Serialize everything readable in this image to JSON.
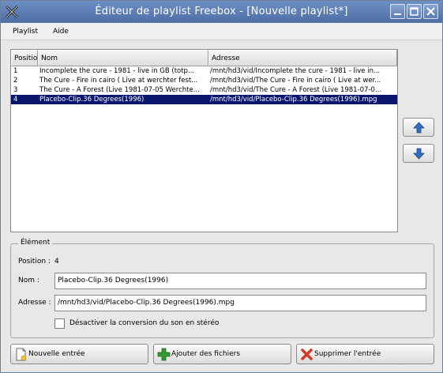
{
  "window": {
    "title": "Éditeur de playlist Freebox - [Nouvelle playlist*]",
    "controls": [
      "minimize-icon",
      "maximize-icon",
      "close-icon"
    ]
  },
  "menu": {
    "items": [
      "Playlist",
      "Aide"
    ]
  },
  "table": {
    "columns": [
      "Positio",
      "Nom",
      "Adresse"
    ],
    "rows": [
      {
        "position": "1",
        "nom": "Incomplete the cure - 1981 - live in GB (totp...",
        "adresse": "/mnt/hd3/vid/Incomplete the cure - 1981 - live in..."
      },
      {
        "position": "2",
        "nom": "The Cure - Fire in cairo ( Live at werchter fest...",
        "adresse": "/mnt/hd3/vid/The Cure - Fire in cairo ( Live at wer..."
      },
      {
        "position": "3",
        "nom": "The Cure - A Forest (Live 1981-07-05 Werchte...",
        "adresse": "/mnt/hd3/vid/The Cure - A Forest (Live 1981-07-0..."
      },
      {
        "position": "4",
        "nom": "Placebo-Clip.36 Degrees(1996)",
        "adresse": "/mnt/hd3/vid/Placebo-Clip.36 Degrees(1996).mpg"
      }
    ],
    "selected_index": 3
  },
  "move": {
    "up_icon": "arrow-up-icon",
    "down_icon": "arrow-down-icon"
  },
  "element": {
    "group_title": "Élément",
    "position_label": "Position :",
    "position_value": "4",
    "name_label": "Nom :",
    "name_value": "Placebo-Clip.36 Degrees(1996)",
    "address_label": "Adresse :",
    "address_value": "/mnt/hd3/vid/Placebo-Clip.36 Degrees(1996).mpg",
    "checkbox_label": "Désactiver la conversion du son en stéréo",
    "checkbox_checked": false
  },
  "buttons": {
    "new_entry": "Nouvelle entrée",
    "add_files": "Ajouter des fichiers",
    "delete_entry": "Supprimer l'entrée"
  },
  "colors": {
    "titlebar": "#5b7db4",
    "selection": "#0a166e",
    "add_icon": "#2e9b2e",
    "delete_icon": "#d23a2a",
    "arrow_icon": "#2f6fc4"
  }
}
